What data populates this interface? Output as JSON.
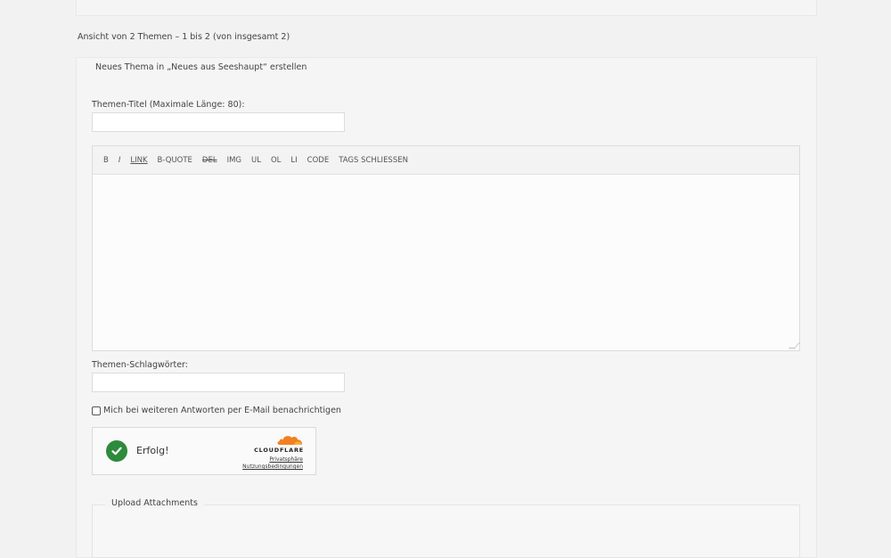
{
  "pagination": {
    "count_text": "Ansicht von 2 Themen – 1 bis 2 (von insgesamt 2)"
  },
  "new_topic": {
    "legend": "Neues Thema in „Neues aus Seeshaupt“ erstellen",
    "title_label": "Themen-Titel (Maximale Länge: 80):",
    "title_value": "",
    "tags_label": "Themen-Schlagwörter:",
    "tags_value": "",
    "notify_label": "Mich bei weiteren Antworten per E-Mail benachrichtigen",
    "notify_checked": false
  },
  "toolbar": {
    "bold": "B",
    "italic": "I",
    "link": "LINK",
    "bquote": "B-QUOTE",
    "del": "DEL",
    "img": "IMG",
    "ul": "UL",
    "ol": "OL",
    "li": "LI",
    "code": "CODE",
    "close_tags": "TAGS SCHLIESSEN"
  },
  "turnstile": {
    "status": "Erfolg!",
    "brand": "CLOUDFLARE",
    "privacy": "Privatsphäre",
    "terms": "Nutzungsbedingungen",
    "icon": "check-circle-icon",
    "success_color": "#2e8a3c",
    "brand_color": "#f38020"
  },
  "attachments": {
    "legend": "Upload Attachments"
  }
}
